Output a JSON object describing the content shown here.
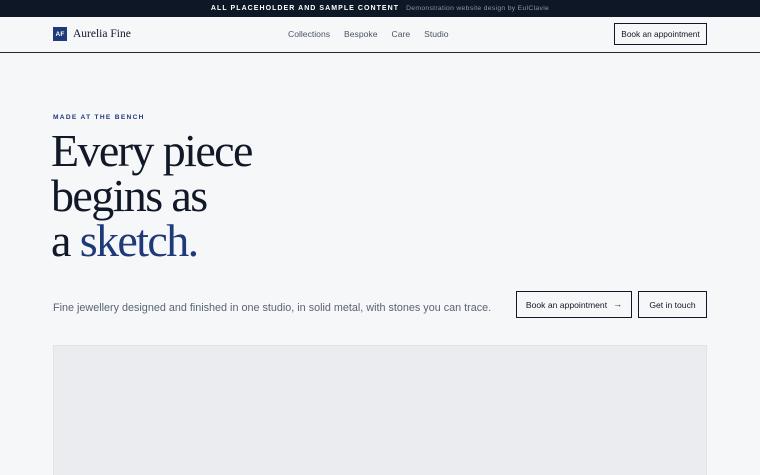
{
  "topbar": {
    "notice": "ALL PLACEHOLDER AND SAMPLE CONTENT",
    "credit": "Demonstration website design by EulClavie"
  },
  "brand": {
    "mark": "AF",
    "name": "Aurelia Fine",
    "accent_color": "#1f3a7a"
  },
  "nav": {
    "items": [
      {
        "label": "Collections"
      },
      {
        "label": "Bespoke"
      },
      {
        "label": "Care"
      },
      {
        "label": "Studio"
      }
    ],
    "cta": "Book an appointment"
  },
  "hero": {
    "eyebrow": "MADE AT THE BENCH",
    "headline": {
      "line1": "Every piece",
      "line2": "begins as",
      "line3_prefix": "a ",
      "line3_accent": "sketch."
    },
    "subtitle": "Fine jewellery designed and finished in one studio, in solid metal, with stones you can trace.",
    "primary_button": "Book an appointment",
    "primary_icon": "arrow-right-icon",
    "secondary_button": "Get in touch"
  }
}
